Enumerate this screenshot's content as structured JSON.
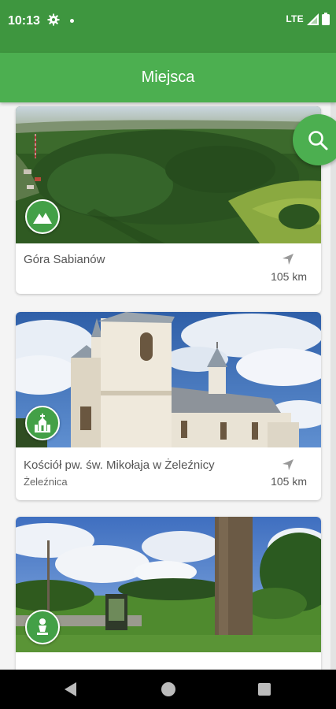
{
  "status_bar": {
    "time": "10:13",
    "network": "LTE",
    "icons": [
      "settings-icon",
      "notification-dot",
      "signal-icon",
      "battery-icon"
    ]
  },
  "app_bar": {
    "title": "Miejsca"
  },
  "search_fab": {
    "icon": "search-icon"
  },
  "places": [
    {
      "title": "Góra Sabianów",
      "subtitle": "",
      "distance": "105 km",
      "category_icon": "mountain-icon"
    },
    {
      "title": "Kościół pw. św. Mikołaja w Żeleźnicy",
      "subtitle": "Żeleźnica",
      "distance": "105 km",
      "category_icon": "church-icon"
    },
    {
      "title": "",
      "subtitle": "",
      "distance": "",
      "category_icon": "monument-icon"
    }
  ],
  "colors": {
    "status_bar": "#3e963f",
    "app_bar": "#4caf50",
    "accent": "#43a047"
  },
  "navigation_bar": {
    "icons": [
      "back-icon",
      "home-icon",
      "recents-icon"
    ]
  }
}
